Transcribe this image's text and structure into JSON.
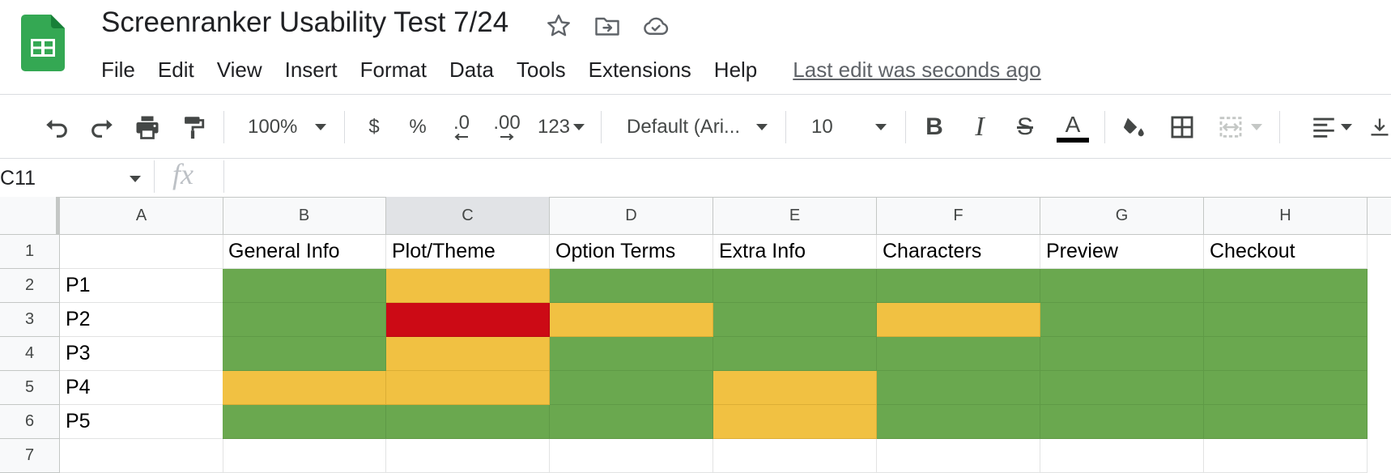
{
  "header": {
    "title": "Screenranker Usability Test 7/24",
    "logo_icon": "google-sheets-logo",
    "title_icons": [
      "star-icon",
      "move-to-folder-icon",
      "cloud-saved-icon"
    ],
    "menu": [
      "File",
      "Edit",
      "View",
      "Insert",
      "Format",
      "Data",
      "Tools",
      "Extensions",
      "Help"
    ],
    "last_edit": "Last edit was seconds ago"
  },
  "toolbar": {
    "zoom": "100%",
    "currency": "$",
    "percent": "%",
    "decrease_decimal": ".0",
    "increase_decimal": ".00",
    "more_formats": "123",
    "font": "Default (Ari...",
    "font_size": "10",
    "bold": "B",
    "italic": "I",
    "strikethrough": "S",
    "text_color_label": "A"
  },
  "formula_bar": {
    "name_box": "C11",
    "fx": "fx",
    "formula": ""
  },
  "sheet": {
    "columns": [
      "A",
      "B",
      "C",
      "D",
      "E",
      "F",
      "G",
      "H"
    ],
    "selected_column": "C",
    "rows": [
      "1",
      "2",
      "3",
      "4",
      "5",
      "6",
      "7"
    ],
    "header_row": [
      "",
      "General Info",
      "Plot/Theme",
      "Option Terms",
      "Extra Info",
      "Characters",
      "Preview",
      "Checkout"
    ],
    "participants": [
      "P1",
      "P2",
      "P3",
      "P4",
      "P5"
    ],
    "status_colors": {
      "green": "#6aa84f",
      "yellow": "#f1c142",
      "red": "#cc0a15"
    },
    "status_grid": [
      [
        "green",
        "yellow",
        "green",
        "green",
        "green",
        "green",
        "green"
      ],
      [
        "green",
        "red",
        "yellow",
        "green",
        "yellow",
        "green",
        "green"
      ],
      [
        "green",
        "yellow",
        "green",
        "green",
        "green",
        "green",
        "green"
      ],
      [
        "yellow",
        "yellow",
        "green",
        "yellow",
        "green",
        "green",
        "green"
      ],
      [
        "green",
        "green",
        "green",
        "yellow",
        "green",
        "green",
        "green"
      ]
    ]
  }
}
